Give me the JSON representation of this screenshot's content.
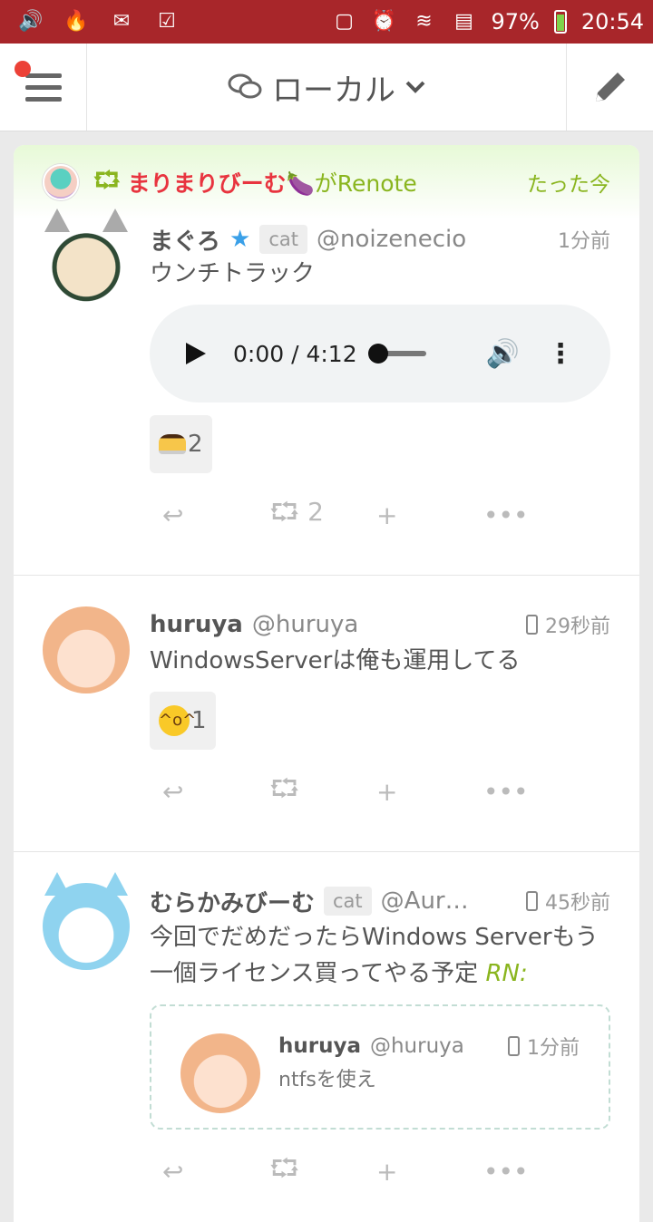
{
  "statusbar": {
    "battery": "97%",
    "time": "20:54"
  },
  "header": {
    "title": "ローカル"
  },
  "renote": {
    "icon": "⮔",
    "user": "まりまりびーむ🍆",
    "suffix": "がRenote",
    "time": "たった今"
  },
  "notes": [
    {
      "name": "まぐろ",
      "cat": "cat",
      "handle": "@noizenecio",
      "time": "1分前",
      "text": "ウンチトラック",
      "audio": {
        "time": "0:00 / 4:12"
      },
      "reaction_count": "2",
      "renote_count": "2"
    },
    {
      "name": "huruya",
      "handle": "@huruya",
      "time": "29秒前",
      "text": "WindowsServerは俺も運用してる",
      "reaction_count": "1"
    },
    {
      "name": "むらかみびーむ",
      "cat": "cat",
      "handle": "@Aur…",
      "time": "45秒前",
      "text": "今回でだめだったらWindows Serverもう一個ライセンス買ってやる予定",
      "rn": "RN:",
      "quote": {
        "name": "huruya",
        "handle": "@huruya",
        "time": "1分前",
        "text": "ntfsを使え"
      }
    }
  ],
  "icons": {
    "reply": "↩",
    "renote": "⮔",
    "add": "+",
    "more": "•••"
  }
}
